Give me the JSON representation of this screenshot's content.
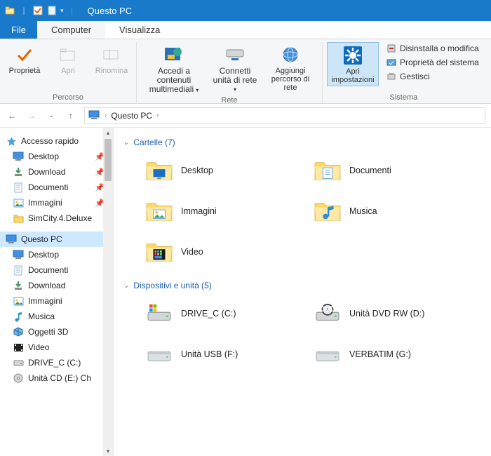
{
  "titlebar": {
    "title": "Questo PC"
  },
  "tabs": {
    "file": "File",
    "computer": "Computer",
    "view": "Visualizza"
  },
  "ribbon": {
    "group_percorso": {
      "label": "Percorso",
      "properties": "Proprietà",
      "open": "Apri",
      "rename": "Rinomina"
    },
    "group_rete": {
      "label": "Rete",
      "media": "Accedi a contenuti multimediali",
      "connect": "Connetti unità di rete",
      "addloc": "Aggiungi percorso di rete"
    },
    "group_sistema": {
      "label": "Sistema",
      "settings": "Apri impostazioni",
      "uninstall": "Disinstalla o modifica",
      "sysprops": "Proprietà del sistema",
      "manage": "Gestisci"
    }
  },
  "breadcrumb": {
    "location": "Questo PC",
    "sep": "›"
  },
  "sidebar": {
    "quick": "Accesso rapido",
    "items_quick": [
      {
        "label": "Desktop",
        "icon": "desktop",
        "pin": true
      },
      {
        "label": "Download",
        "icon": "download",
        "pin": true
      },
      {
        "label": "Documenti",
        "icon": "documents",
        "pin": true
      },
      {
        "label": "Immagini",
        "icon": "pictures",
        "pin": true
      },
      {
        "label": "SimCity.4.Deluxe",
        "icon": "folder",
        "pin": false
      }
    ],
    "thispc": "Questo PC",
    "items_pc": [
      {
        "label": "Desktop",
        "icon": "desktop"
      },
      {
        "label": "Documenti",
        "icon": "documents"
      },
      {
        "label": "Download",
        "icon": "download"
      },
      {
        "label": "Immagini",
        "icon": "pictures"
      },
      {
        "label": "Musica",
        "icon": "music"
      },
      {
        "label": "Oggetti 3D",
        "icon": "3d"
      },
      {
        "label": "Video",
        "icon": "video"
      },
      {
        "label": "DRIVE_C (C:)",
        "icon": "drive"
      },
      {
        "label": "Unità CD (E:) Ch",
        "icon": "cd"
      }
    ]
  },
  "main": {
    "folders_header": "Cartelle (7)",
    "folders": [
      {
        "label": "Desktop",
        "icon": "desktop-big"
      },
      {
        "label": "Documenti",
        "icon": "documents-big"
      },
      {
        "label": "Immagini",
        "icon": "pictures-big"
      },
      {
        "label": "Musica",
        "icon": "music-big"
      },
      {
        "label": "Video",
        "icon": "video-big"
      }
    ],
    "drives_header": "Dispositivi e unità (5)",
    "drives": [
      {
        "label": "DRIVE_C (C:)",
        "icon": "drive-c"
      },
      {
        "label": "Unità DVD RW (D:)",
        "icon": "dvd"
      },
      {
        "label": "Unità USB (F:)",
        "icon": "drive"
      },
      {
        "label": "VERBATIM (G:)",
        "icon": "drive"
      }
    ]
  }
}
